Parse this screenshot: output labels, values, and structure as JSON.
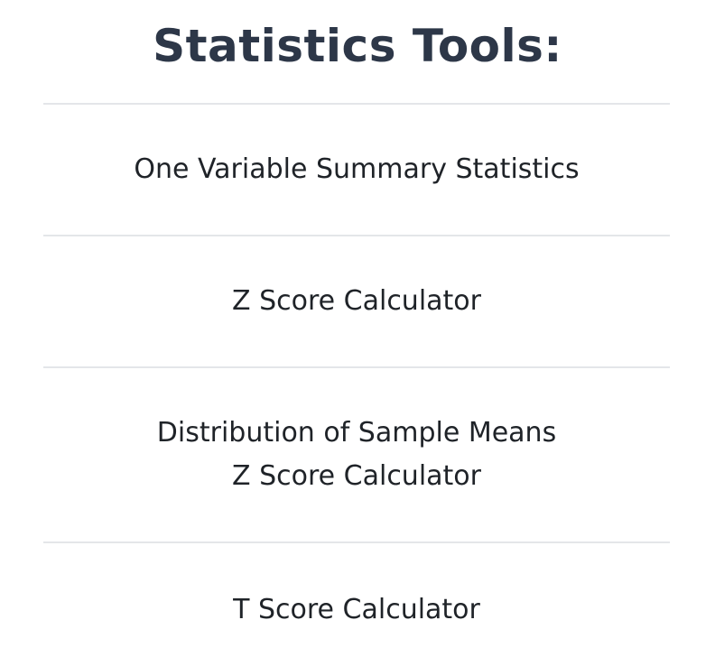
{
  "page": {
    "title": "Statistics Tools:"
  },
  "tools": [
    {
      "label": "One Variable Summary Statistics"
    },
    {
      "label": "Z Score Calculator"
    },
    {
      "label_lines": [
        "Distribution of Sample Means",
        "Z Score Calculator"
      ]
    },
    {
      "label": "T Score Calculator"
    }
  ],
  "colors": {
    "title": "#2d3748",
    "divider": "#e4e6e9",
    "text": "#1f2328",
    "background": "#ffffff"
  }
}
